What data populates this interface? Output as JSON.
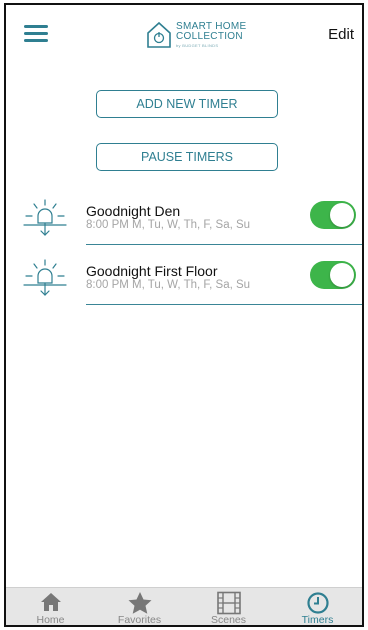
{
  "header": {
    "menu_icon": "hamburger-icon",
    "logo_line1": "SMART HOME",
    "logo_line2": "COLLECTION",
    "logo_line3": "by BUDGET BLINDS",
    "edit_label": "Edit"
  },
  "actions": {
    "add_label": "ADD NEW TIMER",
    "pause_label": "PAUSE TIMERS"
  },
  "timers": [
    {
      "name": "Goodnight Den",
      "schedule": "8:00 PM M, Tu, W, Th, F, Sa, Su",
      "enabled": true,
      "icon": "lamp-timer-icon"
    },
    {
      "name": "Goodnight First Floor",
      "schedule": "8:00 PM M, Tu, W, Th, F, Sa, Su",
      "enabled": true,
      "icon": "lamp-timer-icon"
    }
  ],
  "tabs": [
    {
      "label": "Home",
      "icon": "home-icon",
      "active": false
    },
    {
      "label": "Favorites",
      "icon": "star-icon",
      "active": false
    },
    {
      "label": "Scenes",
      "icon": "film-icon",
      "active": false
    },
    {
      "label": "Timers",
      "icon": "clock-icon",
      "active": true
    }
  ],
  "colors": {
    "accent": "#2f7f91",
    "toggle_on": "#3db54a",
    "tab_inactive": "#888888",
    "tabbar_bg": "#e6e6e6"
  }
}
